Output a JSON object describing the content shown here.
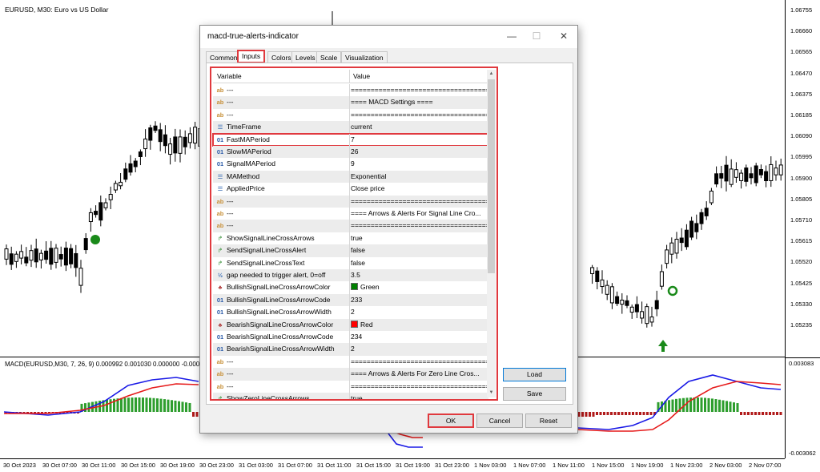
{
  "chart": {
    "title": "EURUSD, M30:  Euro vs US Dollar",
    "macd_title": "MACD(EURUSD,M30, 7, 26, 9) 0.000992 0.001030 0.000000 -0.000038",
    "price_labels": [
      "1.06755",
      "1.06660",
      "1.06565",
      "1.06470",
      "1.06375",
      "1.06185",
      "1.06090",
      "1.05995",
      "1.05900",
      "1.05805",
      "1.05710",
      "1.05615",
      "1.05520",
      "1.05425",
      "1.05330",
      "1.05235"
    ],
    "macd_labels": [
      "0.003083",
      "-0.003062"
    ],
    "time_labels": [
      "30 Oct 2023",
      "30 Oct 07:00",
      "30 Oct 11:00",
      "30 Oct 15:00",
      "30 Oct 19:00",
      "30 Oct 23:00",
      "31 Oct 03:00",
      "31 Oct 07:00",
      "31 Oct 11:00",
      "31 Oct 15:00",
      "31 Oct 19:00",
      "31 Oct 23:00",
      "1 Nov 03:00",
      "1 Nov 07:00",
      "1 Nov 11:00",
      "1 Nov 15:00",
      "1 Nov 19:00",
      "1 Nov 23:00",
      "2 Nov 03:00",
      "2 Nov 07:00"
    ],
    "colors": {
      "bull_marker": "#1a8a1a",
      "macd_blue": "#1a1ae6",
      "signal_red": "#e61a1a",
      "hist_green": "#2e9e2e",
      "hist_red": "#b01a1a"
    }
  },
  "dialog": {
    "title": "macd-true-alerts-indicator",
    "window_buttons": [
      "—",
      "☐",
      "✕"
    ],
    "tabs": [
      "Common",
      "Inputs",
      "Colors",
      "Levels",
      "Scale",
      "Visualization"
    ],
    "active_tab": "Inputs",
    "grid": {
      "col_variable": "Variable",
      "col_value": "Value",
      "rows": [
        {
          "icon": "ab",
          "variable": "---",
          "value": "========================================="
        },
        {
          "icon": "ab",
          "variable": "---",
          "value": "==== MACD Settings ===="
        },
        {
          "icon": "ab",
          "variable": "---",
          "value": "========================================="
        },
        {
          "icon": "enum",
          "variable": "TimeFrame",
          "value": "current"
        },
        {
          "icon": "01",
          "variable": "FastMAPeriod",
          "value": "7"
        },
        {
          "icon": "01",
          "variable": "SlowMAPeriod",
          "value": "26"
        },
        {
          "icon": "01",
          "variable": "SignalMAPeriod",
          "value": "9"
        },
        {
          "icon": "enum",
          "variable": "MAMethod",
          "value": "Exponential"
        },
        {
          "icon": "enum",
          "variable": "AppliedPrice",
          "value": "Close price"
        },
        {
          "icon": "ab",
          "variable": "---",
          "value": "========================================="
        },
        {
          "icon": "ab",
          "variable": "---",
          "value": "==== Arrows & Alerts For Signal Line Cro..."
        },
        {
          "icon": "ab",
          "variable": "---",
          "value": "========================================="
        },
        {
          "icon": "bool",
          "variable": "ShowSignalLineCrossArrows",
          "value": "true"
        },
        {
          "icon": "bool",
          "variable": "SendSignalLineCrossAlert",
          "value": "false"
        },
        {
          "icon": "bool",
          "variable": "SendSignalLineCrossText",
          "value": "false"
        },
        {
          "icon": "dbl",
          "variable": "gap needed to trigger alert, 0=off",
          "value": "3.5"
        },
        {
          "icon": "clr",
          "variable": "BullishSignalLineCrossArrowColor",
          "value": "Green",
          "swatch": "#008000"
        },
        {
          "icon": "01",
          "variable": "BullishSignalLineCrossArrowCode",
          "value": "233"
        },
        {
          "icon": "01",
          "variable": "BullishSignalLineCrossArrowWidth",
          "value": "2"
        },
        {
          "icon": "clr",
          "variable": "BearishSignalLineCrossArrowColor",
          "value": "Red",
          "swatch": "#ff0000"
        },
        {
          "icon": "01",
          "variable": "BearishSignalLineCrossArrowCode",
          "value": "234"
        },
        {
          "icon": "01",
          "variable": "BearishSignalLineCrossArrowWidth",
          "value": "2"
        },
        {
          "icon": "ab",
          "variable": "---",
          "value": "========================================="
        },
        {
          "icon": "ab",
          "variable": "---",
          "value": "==== Arrows & Alerts For Zero Line Cros..."
        },
        {
          "icon": "ab",
          "variable": "---",
          "value": "========================================="
        },
        {
          "icon": "bool",
          "variable": "ShowZeroLineCrossArrows",
          "value": "true"
        }
      ],
      "highlighted_variable": "FastMAPeriod"
    },
    "load_label": "Load",
    "save_label": "Save",
    "ok_label": "OK",
    "cancel_label": "Cancel",
    "reset_label": "Reset"
  }
}
